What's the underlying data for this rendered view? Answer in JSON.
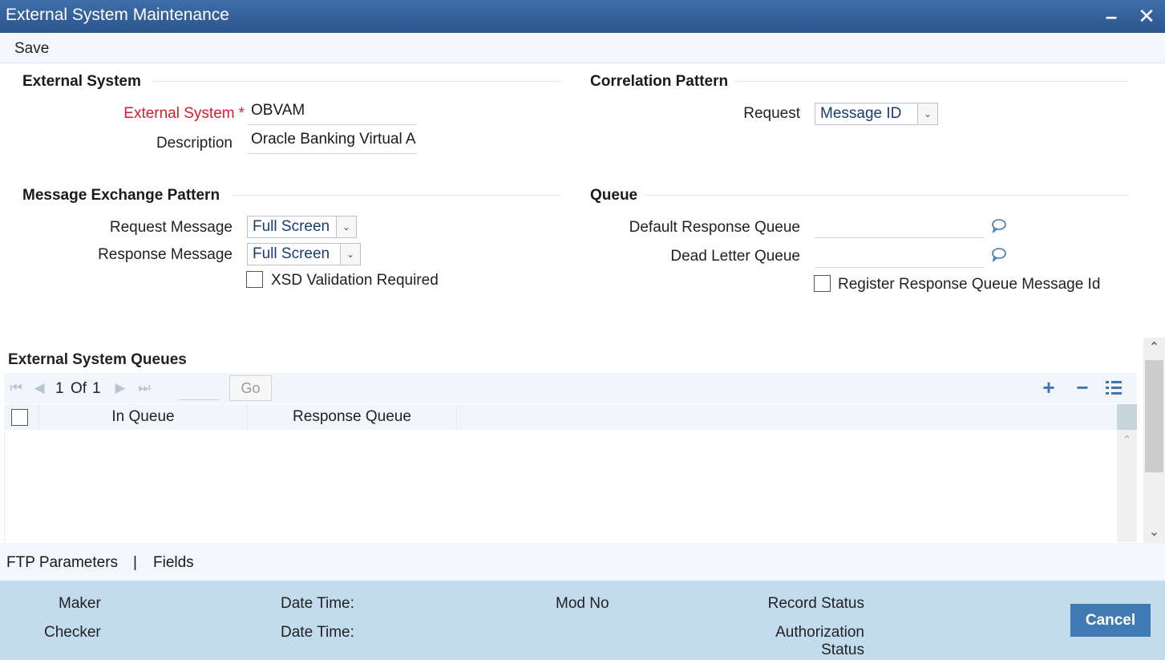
{
  "window": {
    "title": "External System Maintenance",
    "minimize_icon": "minimize-icon",
    "close_icon": "close-icon"
  },
  "toolbar": {
    "save_label": "Save"
  },
  "external_system_section": {
    "title": "External System",
    "external_system_label": "External System",
    "external_system_required": "*",
    "external_system_value": "OBVAM",
    "description_label": "Description",
    "description_value": "Oracle Banking Virtual A"
  },
  "correlation_section": {
    "title": "Correlation Pattern",
    "request_label": "Request",
    "request_value": "Message ID"
  },
  "message_exchange_section": {
    "title": "Message Exchange Pattern",
    "request_message_label": "Request Message",
    "request_message_value": "Full Screen",
    "response_message_label": "Response Message",
    "response_message_value": "Full Screen",
    "xsd_label": "XSD Validation Required"
  },
  "queue_section": {
    "title": "Queue",
    "default_response_label": "Default Response Queue",
    "default_response_value": "",
    "dead_letter_label": "Dead Letter Queue",
    "dead_letter_value": "",
    "register_label": "Register Response Queue Message Id"
  },
  "queues_grid": {
    "title": "External System Queues",
    "page_current": "1",
    "page_of": "Of",
    "page_total": "1",
    "go_label": "Go",
    "columns": [
      "In Queue",
      "Response Queue"
    ],
    "rows": []
  },
  "links": {
    "ftp": "FTP Parameters",
    "separator": "|",
    "fields": "Fields"
  },
  "footer": {
    "maker": "Maker",
    "checker": "Checker",
    "date_time_1": "Date Time:",
    "date_time_2": "Date Time:",
    "mod_no": "Mod No",
    "record_status": "Record Status",
    "auth_status_line1": "Authorization",
    "auth_status_line2": "Status",
    "cancel_label": "Cancel"
  },
  "colors": {
    "title_bar": "#2f5d98",
    "required": "#d2212b",
    "footer_bg": "#c2dbed",
    "button": "#3f7ab5"
  }
}
